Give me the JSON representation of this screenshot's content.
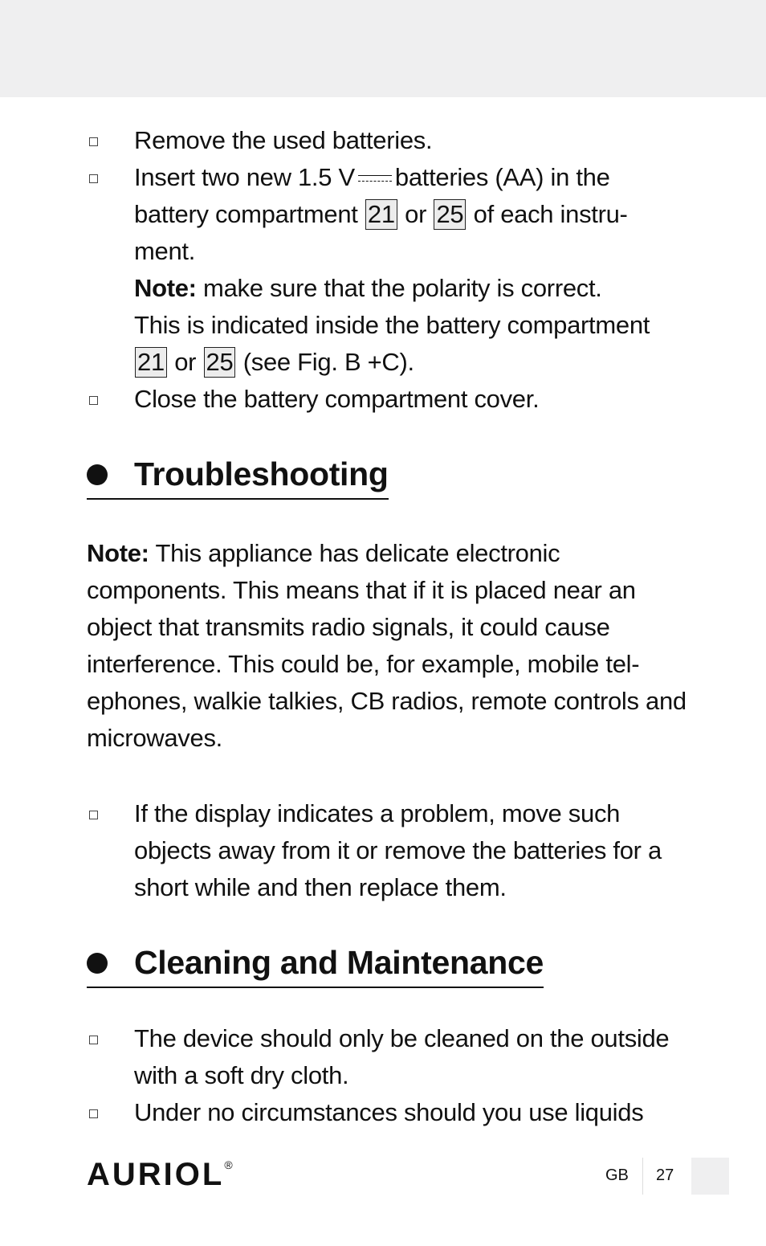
{
  "items_top": [
    {
      "text": "Remove the used batteries."
    },
    {
      "l1a": "Insert two new 1.5 V",
      "l1b": "batteries (AA) in the",
      "l2a": "battery compartment",
      "ref1": "21",
      "or": "or",
      "ref2": "25",
      "l2b": "of each instru-",
      "l3": "ment."
    }
  ],
  "note1": {
    "label": "Note:",
    "t1": "make sure that the polarity is correct.",
    "t2": "This is indicated inside the battery compartment",
    "ref1": "21",
    "or": "or",
    "ref2": "25",
    "t3": "(see Fig. B +C)."
  },
  "item_close": "Close the battery compartment cover.",
  "heading1": "Troubleshooting",
  "note2": {
    "label": "Note:",
    "text": "This appliance has delicate electronic components. This means that if it is placed near an object that transmits radio signals, it could cause interference. This could be, for example, mobile tel-ephones, walkie talkies, CB radios, remote controls and microwaves."
  },
  "item_problem": "If the display indicates a problem, move such objects away from it or remove the batteries for a short while and then replace them.",
  "heading2": "Cleaning and Maintenance",
  "items_clean": [
    "The device should only be cleaned on the outside with a soft dry cloth.",
    "Under no circumstances should you use liquids"
  ],
  "footer": {
    "brand": "AURIOL",
    "reg": "®",
    "lang": "GB",
    "page": "27"
  }
}
